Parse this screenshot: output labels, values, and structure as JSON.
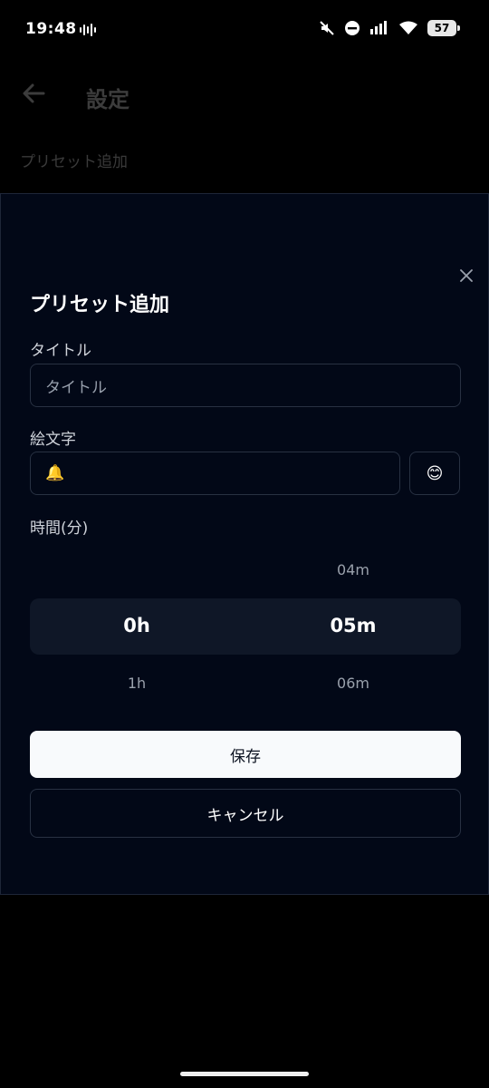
{
  "status_bar": {
    "time": "19:48",
    "battery": "57",
    "icons": [
      "sound-wave-icon",
      "mute-icon",
      "do-not-disturb-icon",
      "signal-icon",
      "wifi-icon",
      "battery-icon"
    ]
  },
  "background": {
    "title": "設定",
    "section_label": "プリセット追加"
  },
  "modal": {
    "title": "プリセット追加",
    "title_field": {
      "label": "タイトル",
      "placeholder": "タイトル",
      "value": ""
    },
    "emoji_field": {
      "label": "絵文字",
      "value": "🔔",
      "picker_icon": "😊"
    },
    "time_field": {
      "label": "時間(分)",
      "hours": {
        "above": "",
        "selected": "0h",
        "below": "1h"
      },
      "minutes": {
        "above": "04m",
        "selected": "05m",
        "below": "06m"
      }
    },
    "save_label": "保存",
    "cancel_label": "キャンセル"
  },
  "colors": {
    "modal_bg": "#020817",
    "border": "#283142",
    "picker_highlight": "#0f1727",
    "primary_button": "#f8fafc"
  }
}
